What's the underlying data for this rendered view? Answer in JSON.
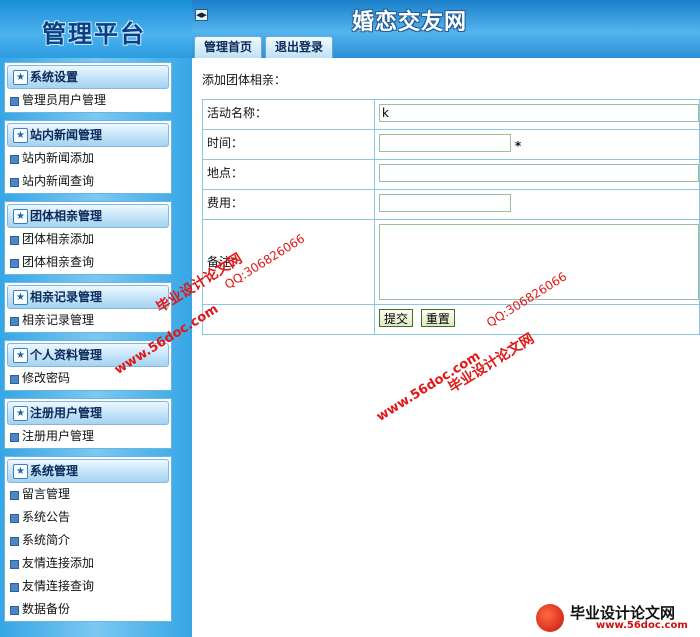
{
  "sidebar": {
    "logo": "管理平台",
    "groups": [
      {
        "title": "系统设置",
        "items": [
          "管理员用户管理"
        ]
      },
      {
        "title": "站内新闻管理",
        "items": [
          "站内新闻添加",
          "站内新闻查询"
        ]
      },
      {
        "title": "团体相亲管理",
        "items": [
          "团体相亲添加",
          "团体相亲查询"
        ]
      },
      {
        "title": "相亲记录管理",
        "items": [
          "相亲记录管理"
        ]
      },
      {
        "title": "个人资料管理",
        "items": [
          "修改密码"
        ]
      },
      {
        "title": "注册用户管理",
        "items": [
          "注册用户管理"
        ]
      },
      {
        "title": "系统管理",
        "items": [
          "留言管理",
          "系统公告",
          "系统简介",
          "友情连接添加",
          "友情连接查询",
          "数据备份"
        ]
      }
    ]
  },
  "header": {
    "toggle": "◀▶",
    "site_title": "婚恋交友网",
    "tabs": [
      "管理首页",
      "退出登录"
    ]
  },
  "form": {
    "caption": "添加团体相亲：",
    "name_label": "活动名称：",
    "name_value": "k",
    "time_label": "时间：",
    "time_required": "*",
    "place_label": "地点：",
    "fee_label": "费用：",
    "note_label": "备注：",
    "submit": "提交",
    "reset": "重置"
  },
  "watermarks": {
    "site_name": "毕业设计论文网",
    "site_url": "www.56doc.com",
    "qq": "QQ:306826066",
    "footer_name": "毕业设计论文网",
    "footer_url": "www.56doc.com"
  },
  "colors": {
    "sidebar_blue": "#35a6e6",
    "banner_blue": "#1b7fca",
    "table_border": "#8cc6e8",
    "watermark_red": "#e01818"
  }
}
